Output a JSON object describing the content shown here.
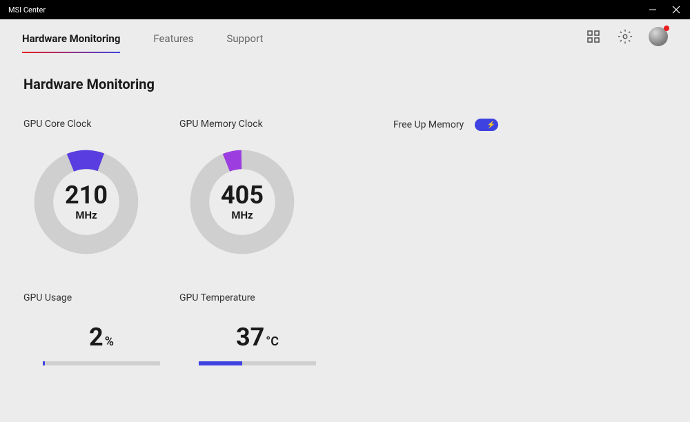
{
  "window": {
    "title": "MSI Center"
  },
  "tabs": [
    {
      "label": "Hardware Monitoring",
      "active": true
    },
    {
      "label": "Features",
      "active": false
    },
    {
      "label": "Support",
      "active": false
    }
  ],
  "page": {
    "title": "Hardware Monitoring"
  },
  "gauges": {
    "core_clock": {
      "label": "GPU Core Clock",
      "value": "210",
      "unit": "MHz",
      "percent": 12
    },
    "memory_clock": {
      "label": "GPU Memory Clock",
      "value": "405",
      "unit": "MHz",
      "percent": 6
    }
  },
  "free_memory": {
    "label": "Free Up Memory",
    "enabled": true
  },
  "usage": {
    "gpu_usage": {
      "label": "GPU Usage",
      "value": "2",
      "unit": "%",
      "percent": 2
    },
    "gpu_temp": {
      "label": "GPU Temperature",
      "value": "37",
      "unit": "°C",
      "percent": 37
    }
  },
  "colors": {
    "accent": "#3d42e0",
    "gauge1": "#5a3de0",
    "gauge2": "#9c3de0",
    "track": "#cfcfcf"
  }
}
